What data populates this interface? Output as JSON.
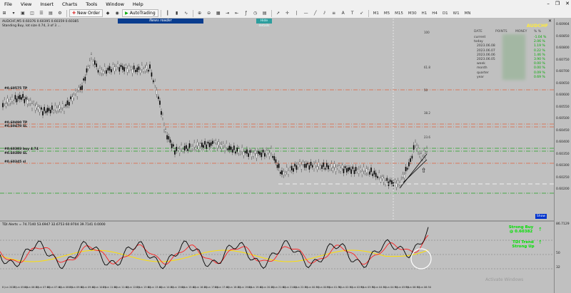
{
  "menu": {
    "items": [
      "File",
      "View",
      "Insert",
      "Charts",
      "Tools",
      "Window",
      "Help"
    ]
  },
  "toolbar": {
    "new_order_label": "New Order",
    "autotrading_label": "AutoTrading",
    "timeframes": [
      "M1",
      "M5",
      "M15",
      "M30",
      "H1",
      "H4",
      "D1",
      "W1",
      "MN"
    ]
  },
  "chart": {
    "header": "AUDCHF,M5  0.60376 0.60395 0.60359 0.60385",
    "subheader": "Standing Buy, lot size 4.74, 3 of 3 ...",
    "news_label": "News reader",
    "show_label": "Hide details",
    "show_button": "Show",
    "price_labels": [
      "0.60904",
      "0.60850",
      "0.60800",
      "0.60750",
      "0.60700",
      "0.60650",
      "0.60600",
      "0.60550",
      "0.60500",
      "0.60450",
      "0.60400",
      "0.60350",
      "0.60300",
      "0.60250",
      "0.60200"
    ],
    "level_labels": [
      "#0.60575 TP",
      "#0.60490 TP",
      "#0.60470 SL",
      "#0.60383 buy 4.74",
      "#0.60380 SL",
      "#0.60345 sl"
    ]
  },
  "stats": {
    "title": "AUDCHF",
    "headers": [
      "DATE",
      "POINTS",
      "MONEY",
      "% %"
    ],
    "rows": [
      {
        "label": "current",
        "value": "-1.04 %"
      },
      {
        "label": "today",
        "value": "2.06 %"
      },
      {
        "label": "2023.06.08",
        "value": "1.19 %"
      },
      {
        "label": "2023.06.07",
        "value": "0.22 %"
      },
      {
        "label": "2023.06.06",
        "value": "1.46 %"
      },
      {
        "label": "2023.06.05",
        "value": "3.90 %"
      },
      {
        "label": "week",
        "value": "0.00 %"
      },
      {
        "label": "month",
        "value": "0.00 %"
      },
      {
        "label": "quarter",
        "value": "0.09 %"
      },
      {
        "label": "year",
        "value": "0.69 %"
      }
    ]
  },
  "tdi": {
    "header": "TDI Alerts = 74.7140 53.6947 32.6753 60.9704 39.7141 0.0000",
    "signal1_line1": "Strong Buy",
    "signal1_line2": "@ 0.60382",
    "signal2_line1": "TDI Trend",
    "signal2_line2": "Strong Up",
    "axis_labels": [
      "86.7129",
      "50",
      "32"
    ]
  },
  "time_axis": [
    "8 Jun 2023",
    "8 Jun 05:40",
    "8 Jun 06:20",
    "8 Jun 07:00",
    "8 Jun 07:40",
    "8 Jun 08:20",
    "8 Jun 09:00",
    "8 Jun 09:40",
    "8 Jun 10:20",
    "8 Jun 11:00",
    "8 Jun 11:40",
    "8 Jun 12:20",
    "8 Jun 13:00",
    "8 Jun 13:40",
    "8 Jun 14:20",
    "8 Jun 15:00",
    "8 Jun 15:40",
    "8 Jun 16:20",
    "8 Jun 17:00",
    "8 Jun 17:40",
    "8 Jun 18:20",
    "8 Jun 19:00",
    "8 Jun 19:40",
    "8 Jun 20:20",
    "8 Jun 21:00",
    "8 Jun 21:40",
    "8 Jun 22:20",
    "9 Jun 00:10",
    "9 Jun 00:50",
    "9 Jun 01:30",
    "9 Jun 02:10",
    "9 Jun 02:50",
    "9 Jun 03:30",
    "9 Jun 04:10",
    "9 Jun 04:50",
    "9 Jun 05:30",
    "9 Jun 06:10",
    "9 Jun 06:50"
  ],
  "watermark": "Activate Windows",
  "colors": {
    "tp_line": "#e0603a",
    "sl_line": "#e0603a",
    "buy_line": "#20a020",
    "rsi": "#000000",
    "signal": "#ff2020",
    "band": "#ffe000",
    "alert_green": "#00e000",
    "stat_title": "#ffeb3b"
  }
}
